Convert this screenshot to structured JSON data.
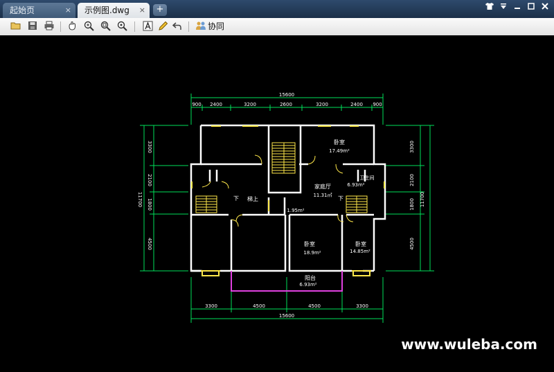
{
  "tabs": [
    {
      "label": "起始页",
      "close": "×"
    },
    {
      "label": "示例图.dwg",
      "close": "×"
    }
  ],
  "new_tab_label": "+",
  "window_controls": [
    "shirt-icon",
    "menu-icon",
    "minimize-icon",
    "maximize-icon",
    "close-icon"
  ],
  "toolbar": {
    "collab_label": "协同",
    "icons": [
      "open-icon",
      "save-icon",
      "print-icon",
      "pan-icon",
      "zoom-in-icon",
      "zoom-window-icon",
      "zoom-out-icon",
      "text-icon",
      "pencil-icon",
      "undo-icon",
      "collab-icon"
    ]
  },
  "drawing": {
    "dim_top_total": "15600",
    "dim_top": [
      "900",
      "2400",
      "3200",
      "2600",
      "3200",
      "2400",
      "900"
    ],
    "dim_bottom": [
      "3300",
      "4500",
      "4500",
      "3300"
    ],
    "dim_bottom_total": "15600",
    "dim_left": [
      "3300",
      "2100",
      "1800",
      "4500"
    ],
    "dim_left_total": "11700",
    "dim_right": [
      "3300",
      "2100",
      "1800",
      "4500"
    ],
    "dim_right_total": "11700",
    "rooms": {
      "bedroom_top_name": "卧室",
      "bedroom_top_area": "17.49m²",
      "bathroom_name": "卫生间",
      "bathroom_area": "6.93m²",
      "family_name": "家庭厅",
      "family_area": "11.31㎡",
      "stair_down_left": "下",
      "stair_label": "梯上",
      "stair_down_right": "下",
      "small_area": "1.95m²",
      "bedroom_mid_name": "卧室",
      "bedroom_mid_area": "18.9m²",
      "bedroom_right_name": "卧室",
      "bedroom_right_area": "14.85m²",
      "balcony_name": "阳台",
      "balcony_area": "6.93m²"
    }
  },
  "watermark": "www.wuleba.com"
}
